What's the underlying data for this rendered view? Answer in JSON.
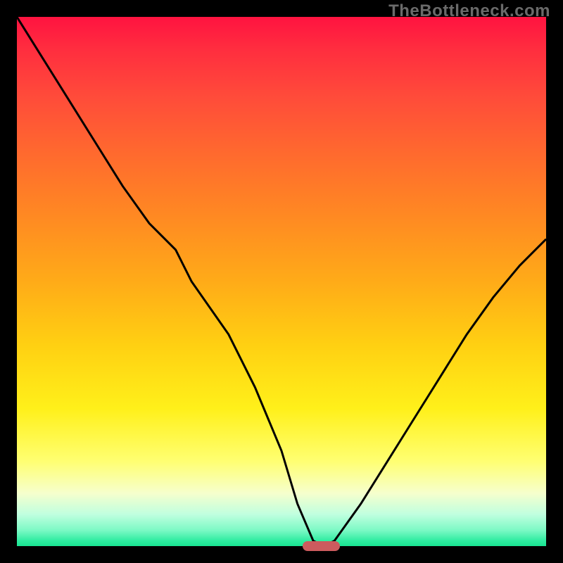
{
  "watermark": "TheBottleneck.com",
  "colors": {
    "frame": "#000000",
    "watermark_text": "#6a6a6a",
    "curve": "#000000",
    "marker": "#cc5b5e",
    "gradient_top": "#ff1340",
    "gradient_bottom": "#19e592"
  },
  "chart_data": {
    "type": "line",
    "title": "",
    "xlabel": "",
    "ylabel": "",
    "xlim": [
      0,
      100
    ],
    "ylim": [
      0,
      100
    ],
    "grid": false,
    "legend": false,
    "series": [
      {
        "name": "bottleneck-curve",
        "x": [
          0,
          5,
          10,
          15,
          20,
          25,
          30,
          33,
          40,
          45,
          50,
          53,
          56,
          58,
          60,
          65,
          70,
          75,
          80,
          85,
          90,
          95,
          100
        ],
        "values": [
          100,
          92,
          84,
          76,
          68,
          61,
          56,
          50,
          40,
          30,
          18,
          8,
          1,
          0,
          1,
          8,
          16,
          24,
          32,
          40,
          47,
          53,
          58
        ]
      }
    ],
    "annotations": [
      {
        "name": "optimal-marker",
        "x_start": 54,
        "x_end": 61,
        "y": 0
      }
    ]
  }
}
